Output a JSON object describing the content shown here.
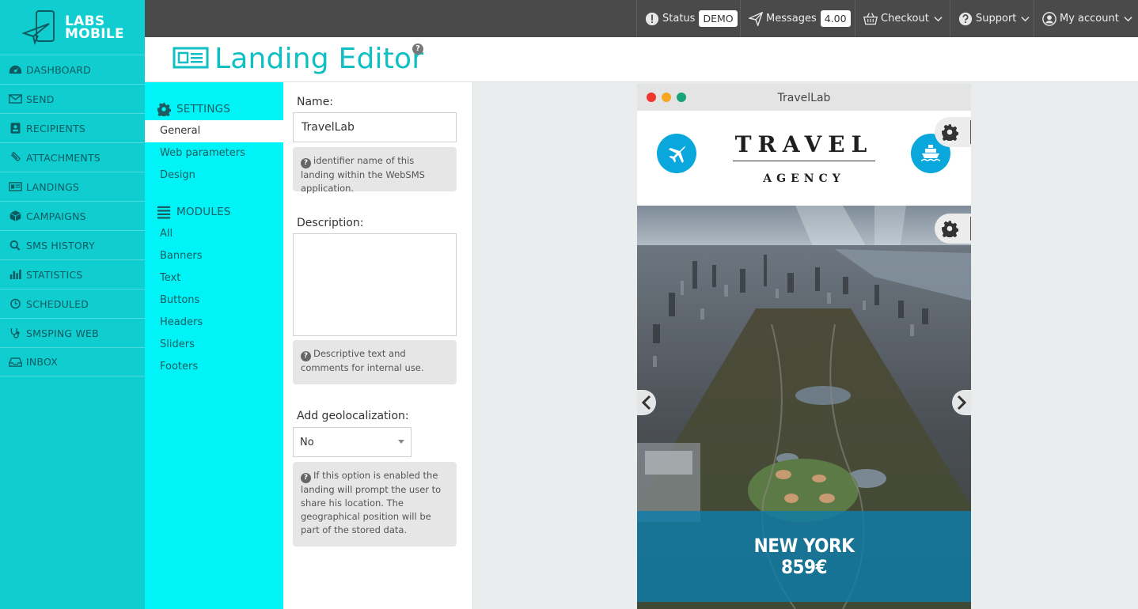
{
  "brand": {
    "line1": "LABS",
    "line2": "MOBILE"
  },
  "nav": [
    {
      "label": "DASHBOARD",
      "icon": "dashboard-icon"
    },
    {
      "label": "SEND",
      "icon": "envelope-icon"
    },
    {
      "label": "RECIPIENTS",
      "icon": "contact-card-icon"
    },
    {
      "label": "ATTACHMENTS",
      "icon": "paperclip-icon"
    },
    {
      "label": "LANDINGS",
      "icon": "newspaper-icon"
    },
    {
      "label": "CAMPAIGNS",
      "icon": "cube-icon"
    },
    {
      "label": "SMS HISTORY",
      "icon": "search-icon"
    },
    {
      "label": "STATISTICS",
      "icon": "bar-chart-icon"
    },
    {
      "label": "SCHEDULED",
      "icon": "clock-icon"
    },
    {
      "label": "SMSPING WEB",
      "icon": "stethoscope-icon"
    },
    {
      "label": "INBOX",
      "icon": "inbox-icon"
    }
  ],
  "topbar": {
    "status_label": "Status",
    "status_value": "DEMO",
    "messages_label": "Messages",
    "messages_value": "4.00",
    "checkout_label": "Checkout",
    "support_label": "Support",
    "account_label": "My account"
  },
  "header": {
    "title": "Landing Editor",
    "help": "?"
  },
  "settings_panel": {
    "settings_title": "SETTINGS",
    "settings_items": [
      "General",
      "Web parameters",
      "Design"
    ],
    "modules_title": "MODULES",
    "module_items": [
      "All",
      "Banners",
      "Text",
      "Buttons",
      "Headers",
      "Sliders",
      "Footers"
    ]
  },
  "form": {
    "name_label": "Name:",
    "name_value": "TravelLab",
    "name_help": "identifier name of this landing within the WebSMS application.",
    "description_label": "Description:",
    "description_value": "",
    "description_help": "Descriptive text and comments for internal use.",
    "geo_label": "Add geolocalization:",
    "geo_value": "No",
    "geo_help": "If this option is enabled the landing will prompt the user to share his location. The geographical position will be part of the stored data."
  },
  "preview": {
    "window_title": "TravelLab",
    "brand_line1": "TRAVEL",
    "brand_line2": "AGENCY",
    "slide_city": "NEW YORK",
    "slide_price": "859€"
  },
  "colors": {
    "sidebar": "#10cdd0",
    "settings_panel": "#00f3f7",
    "title": "#10bfc3",
    "topbar": "#4a4a4a",
    "icon_blue": "#0aa7dc",
    "caption": "#0f7daa"
  }
}
